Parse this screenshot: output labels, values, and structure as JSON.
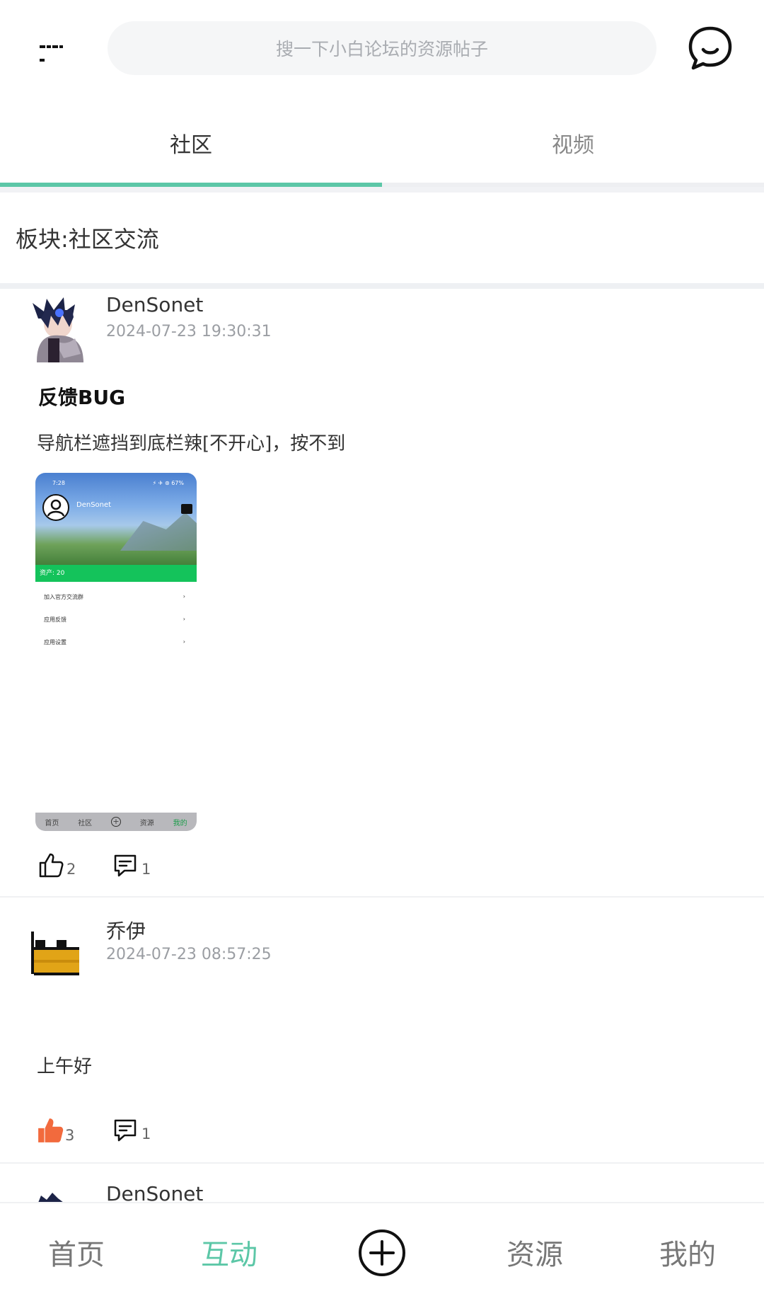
{
  "header": {
    "search_placeholder": "搜一下小白论坛的资源帖子",
    "logo_icon": "logo-icon",
    "message_icon": "chat-bubble-icon"
  },
  "tabs": [
    {
      "label": "社区",
      "active": true
    },
    {
      "label": "视频",
      "active": false
    }
  ],
  "board": {
    "label": "板块:社区交流"
  },
  "posts": [
    {
      "author": "DenSonet",
      "time": "2024-07-23 19:30:31",
      "title": "反馈BUG",
      "body": "导航栏遮挡到底栏辣[不开心]，按不到",
      "likes": "2",
      "liked": false,
      "comments": "1",
      "image": {
        "status_time": "7:28",
        "status_right": "⚡ ✈ ⊛ 67%",
        "profile_name": "DenSonet",
        "assets_label": "资产: 20",
        "rows": [
          {
            "label": "加入官方交流群",
            "value": "›"
          },
          {
            "label": "应用反馈",
            "value": "›"
          },
          {
            "label": "应用设置",
            "value": "›"
          }
        ],
        "nav": [
          "首页",
          "社区",
          "资源",
          "我的"
        ]
      }
    },
    {
      "author": "乔伊",
      "time": "2024-07-23 08:57:25",
      "title": "",
      "body": "上午好",
      "likes": "3",
      "liked": true,
      "comments": "1"
    },
    {
      "author": "DenSonet"
    }
  ],
  "bottom_nav": [
    {
      "label": "首页",
      "active": false
    },
    {
      "label": "互动",
      "active": true
    },
    {
      "label": "资源",
      "active": false
    },
    {
      "label": "我的",
      "active": false
    }
  ],
  "colors": {
    "accent": "#5cc7a7",
    "like_active": "#f26a3d",
    "green_bar": "#14c35b"
  }
}
